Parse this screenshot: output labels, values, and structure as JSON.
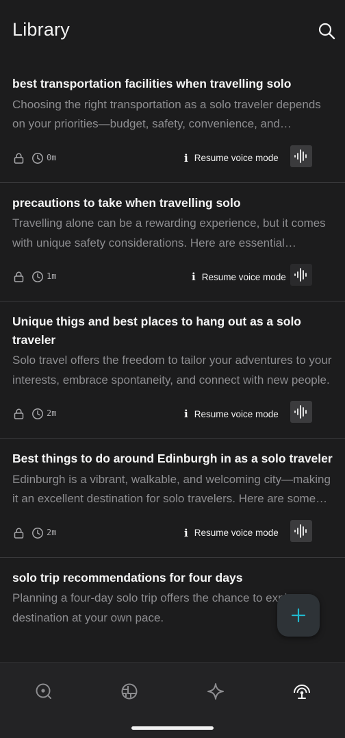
{
  "header": {
    "title": "Library",
    "search_icon": "search-icon"
  },
  "threads": [
    {
      "title": "best transportation facilities when travelling solo",
      "preview": "Choosing the right transportation as a solo traveler depends on your priorities—budget, safety, convenience, and experience.",
      "duration": "0m",
      "resume_label": "Resume voice mode"
    },
    {
      "title": "precautions to take when travelling solo",
      "preview": "Travelling alone can be a rewarding experience, but it comes with unique safety considerations. Here are essential precautions.",
      "duration": "1m",
      "resume_label": "Resume voice mode"
    },
    {
      "title": "Unique thigs and best places to hang out as a solo traveler",
      "preview": "Solo travel offers the freedom to tailor your adventures to your interests, embrace spontaneity, and connect with new people.",
      "duration": "2m",
      "resume_label": "Resume voice mode"
    },
    {
      "title": "Best things to do around Edinburgh in as a solo traveler",
      "preview": "Edinburgh is a vibrant, walkable, and welcoming city—making it an excellent destination for solo travelers. Here are some ideas.",
      "duration": "2m",
      "resume_label": "Resume voice mode"
    },
    {
      "title": "solo trip recommendations for four days",
      "preview": "Planning a four-day solo trip offers the chance to explore a destination at your own pace.",
      "duration": "",
      "resume_label": ""
    }
  ],
  "icons": {
    "lock": "lock-icon",
    "clock": "clock-icon",
    "info": "info-icon",
    "voice": "voice-waveform-icon",
    "fab": "plus-icon"
  },
  "bottom_nav": [
    "discover-icon",
    "spaces-icon",
    "sparkle-icon",
    "library-icon"
  ],
  "colors": {
    "accent": "#20b8cd",
    "background": "#1c1c1d",
    "muted_text": "#8d8d90"
  }
}
